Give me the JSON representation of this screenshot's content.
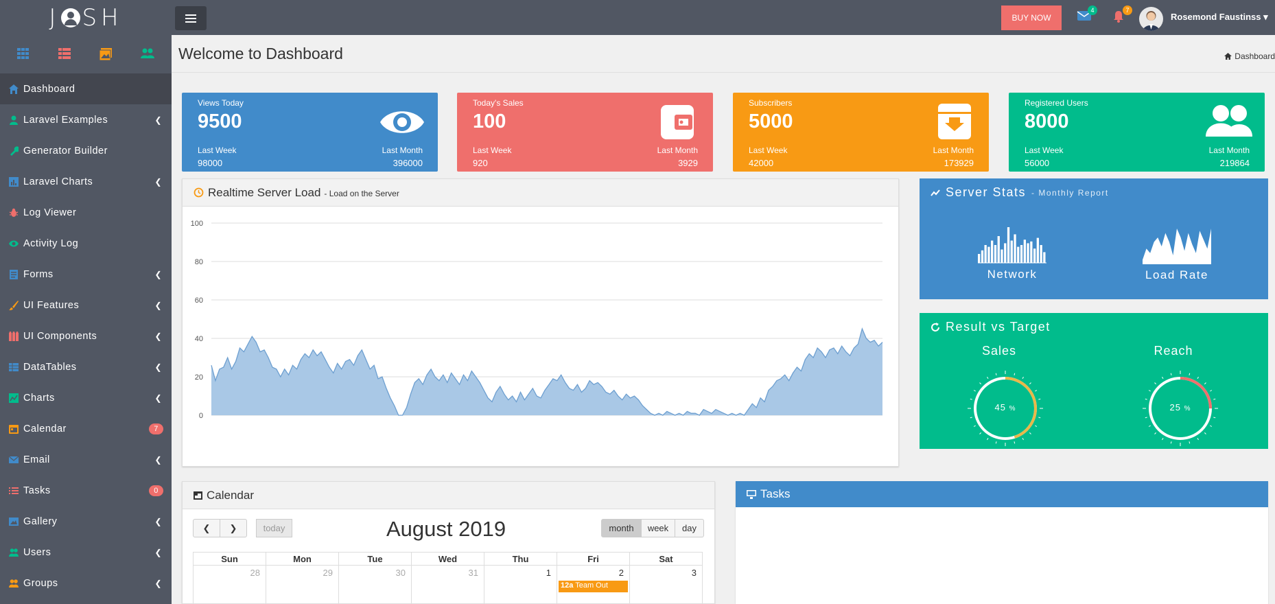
{
  "topbar": {
    "logo_left": "J",
    "logo_right": "SH",
    "buy_now": "BUY NOW",
    "mail_count": "4",
    "notif_count": "7",
    "user_name": "Rosemond Faustinss",
    "colors": {
      "bg": "#515763",
      "buy": "#ef6f6c",
      "mail_badge": "#01bc8c",
      "notif_badge": "#f89a14"
    }
  },
  "sidebar": {
    "quick_icons": [
      "grid-icon",
      "table-icon",
      "gallery-icon",
      "users-icon"
    ],
    "items": [
      {
        "label": "Dashboard",
        "icon": "home-icon",
        "color": "#418bca",
        "chevron": false,
        "badge": ""
      },
      {
        "label": "Laravel Examples",
        "icon": "laravel-icon",
        "color": "#01bc8c",
        "chevron": true,
        "badge": ""
      },
      {
        "label": "Generator Builder",
        "icon": "wrench-icon",
        "color": "#01bc8c",
        "chevron": false,
        "badge": ""
      },
      {
        "label": "Laravel Charts",
        "icon": "chart-icon",
        "color": "#418bca",
        "chevron": true,
        "badge": ""
      },
      {
        "label": "Log Viewer",
        "icon": "bug-icon",
        "color": "#ef6f6c",
        "chevron": false,
        "badge": ""
      },
      {
        "label": "Activity Log",
        "icon": "eye-icon",
        "color": "#01bc8c",
        "chevron": false,
        "badge": ""
      },
      {
        "label": "Forms",
        "icon": "form-icon",
        "color": "#418bca",
        "chevron": true,
        "badge": ""
      },
      {
        "label": "UI Features",
        "icon": "brush-icon",
        "color": "#f89a14",
        "chevron": true,
        "badge": ""
      },
      {
        "label": "UI Components",
        "icon": "components-icon",
        "color": "#ef6f6c",
        "chevron": true,
        "badge": ""
      },
      {
        "label": "DataTables",
        "icon": "datatable-icon",
        "color": "#418bca",
        "chevron": true,
        "badge": ""
      },
      {
        "label": "Charts",
        "icon": "charts-icon",
        "color": "#01bc8c",
        "chevron": true,
        "badge": ""
      },
      {
        "label": "Calendar",
        "icon": "calendar-icon",
        "color": "#f89a14",
        "chevron": false,
        "badge": "7"
      },
      {
        "label": "Email",
        "icon": "mail-icon",
        "color": "#418bca",
        "chevron": true,
        "badge": ""
      },
      {
        "label": "Tasks",
        "icon": "list-icon",
        "color": "#ef6f6c",
        "chevron": false,
        "badge": "0"
      },
      {
        "label": "Gallery",
        "icon": "image-icon",
        "color": "#418bca",
        "chevron": true,
        "badge": ""
      },
      {
        "label": "Users",
        "icon": "user-icon",
        "color": "#01bc8c",
        "chevron": true,
        "badge": ""
      },
      {
        "label": "Groups",
        "icon": "group-icon",
        "color": "#f89a14",
        "chevron": true,
        "badge": ""
      }
    ]
  },
  "header": {
    "title": "Welcome to Dashboard",
    "breadcrumb": "Dashboard"
  },
  "stats": [
    {
      "label": "Views Today",
      "value": "9500",
      "last_week_label": "Last Week",
      "last_month_label": "Last Month",
      "last_week": "98000",
      "last_month": "396000",
      "color": "#418bca",
      "icon": "eye-icon"
    },
    {
      "label": "Today's Sales",
      "value": "100",
      "last_week_label": "Last Week",
      "last_month_label": "Last Month",
      "last_week": "920",
      "last_month": "3929",
      "color": "#ef6f6c",
      "icon": "wallet-icon"
    },
    {
      "label": "Subscribers",
      "value": "5000",
      "last_week_label": "Last Week",
      "last_month_label": "Last Month",
      "last_week": "42000",
      "last_month": "173929",
      "color": "#f89a14",
      "icon": "inbox-icon"
    },
    {
      "label": "Registered Users",
      "value": "8000",
      "last_week_label": "Last Week",
      "last_month_label": "Last Month",
      "last_week": "56000",
      "last_month": "219864",
      "color": "#01bc8c",
      "icon": "users-icon"
    }
  ],
  "realtime": {
    "title": "Realtime Server Load",
    "subtitle": "- Load on the Server"
  },
  "chart_data": {
    "type": "area",
    "title": "",
    "xlabel": "",
    "ylabel": "",
    "ylim": [
      0,
      100
    ],
    "yticks": [
      0,
      20,
      40,
      60,
      80,
      100
    ],
    "grid": true,
    "color": "#418bca",
    "values": [
      26,
      18,
      24,
      25,
      30,
      24,
      28,
      35,
      33,
      37,
      41,
      38,
      33,
      34,
      30,
      25,
      24,
      20,
      24,
      21,
      26,
      24,
      29,
      32,
      30,
      34,
      31,
      33,
      29,
      25,
      22,
      27,
      24,
      28,
      29,
      26,
      31,
      34,
      29,
      24,
      26,
      19,
      20,
      14,
      9,
      5,
      0,
      0,
      4,
      11,
      17,
      19,
      16,
      21,
      24,
      20,
      18,
      21,
      17,
      22,
      19,
      16,
      21,
      18,
      23,
      20,
      17,
      13,
      9,
      7,
      12,
      15,
      11,
      8,
      10,
      7,
      12,
      8,
      11,
      14,
      10,
      9,
      13,
      16,
      19,
      18,
      21,
      17,
      14,
      13,
      16,
      12,
      14,
      18,
      16,
      17,
      15,
      12,
      11,
      13,
      10,
      8,
      11,
      9,
      10,
      8,
      5,
      3,
      1,
      0,
      1,
      0,
      2,
      1,
      0,
      1,
      0,
      2,
      1,
      1,
      0,
      3,
      2,
      1,
      3,
      2,
      1,
      0,
      1,
      0,
      1,
      0,
      3,
      6,
      4,
      9,
      7,
      13,
      15,
      18,
      19,
      21,
      18,
      22,
      25,
      23,
      29,
      32,
      30,
      35,
      33,
      30,
      34,
      35,
      32,
      36,
      33,
      31,
      35,
      37,
      45,
      40,
      38,
      39,
      36,
      38
    ]
  },
  "server_stats": {
    "title": "Server Stats",
    "subtitle": "- Monthly Report",
    "network_label": "Network",
    "loadrate_label": "Load Rate",
    "network_bars": [
      10,
      14,
      20,
      18,
      25,
      20,
      30,
      15,
      22,
      40,
      25,
      32,
      18,
      20,
      26,
      22,
      24,
      16,
      28,
      20,
      12
    ],
    "load_points": [
      2,
      7,
      5,
      10,
      12,
      8,
      14,
      10,
      4,
      16,
      12,
      6,
      14,
      9,
      5,
      15,
      11,
      7,
      16
    ]
  },
  "result_target": {
    "title": "Result vs Target",
    "sales_label": "Sales",
    "reach_label": "Reach",
    "sales_value": "45",
    "reach_value": "25",
    "percent": "%",
    "sales_color": "#e8b84a",
    "reach_color": "#ef6f6c"
  },
  "calendar": {
    "title": "Calendar",
    "month_title": "August 2019",
    "today_label": "today",
    "views": [
      "month",
      "week",
      "day"
    ],
    "days": [
      "Sun",
      "Mon",
      "Tue",
      "Wed",
      "Thu",
      "Fri",
      "Sat"
    ],
    "dates": [
      "28",
      "29",
      "30",
      "31",
      "1",
      "2",
      "3"
    ],
    "event_time": "12a",
    "event_title": "Team Out"
  },
  "tasks": {
    "title": "Tasks"
  }
}
